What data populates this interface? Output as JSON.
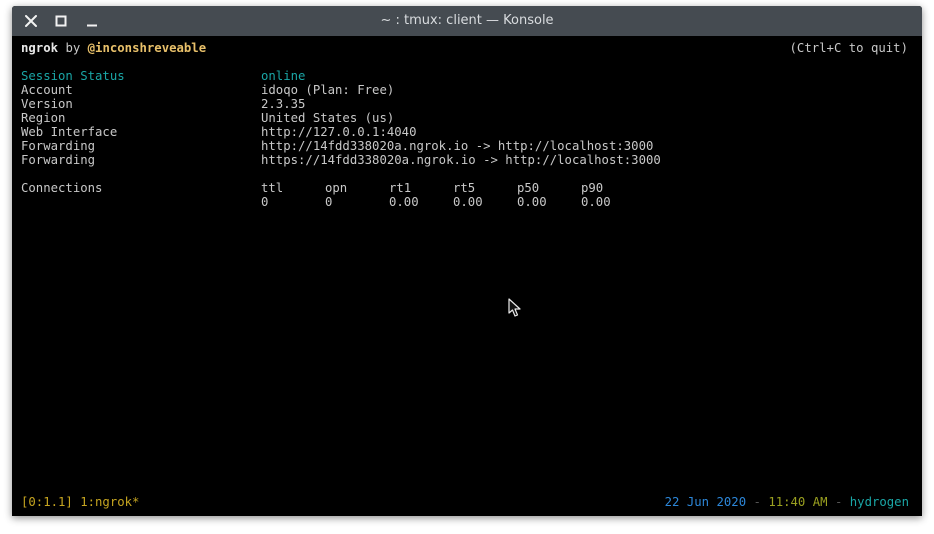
{
  "window": {
    "title": "~ : tmux: client — Konsole",
    "buttons": {
      "close_icon": "close-icon",
      "maximize_icon": "maximize-icon",
      "minimize_icon": "minimize-icon"
    }
  },
  "ngrok": {
    "brand": "ngrok",
    "by": "by",
    "author": "@inconshreveable",
    "quit_hint": "(Ctrl+C to quit)",
    "fields": [
      {
        "label": "Session Status",
        "value": "online"
      },
      {
        "label": "Account",
        "value": "idoqo (Plan: Free)"
      },
      {
        "label": "Version",
        "value": "2.3.35"
      },
      {
        "label": "Region",
        "value": "United States (us)"
      },
      {
        "label": "Web Interface",
        "value": "http://127.0.0.1:4040"
      },
      {
        "label": "Forwarding",
        "value": "http://14fdd338020a.ngrok.io -> http://localhost:3000"
      },
      {
        "label": "Forwarding",
        "value": "https://14fdd338020a.ngrok.io -> http://localhost:3000"
      }
    ],
    "connections": {
      "label": "Connections",
      "headers": [
        "ttl",
        "opn",
        "rt1",
        "rt5",
        "p50",
        "p90"
      ],
      "values": [
        "0",
        "0",
        "0.00",
        "0.00",
        "0.00",
        "0.00"
      ]
    }
  },
  "tmux": {
    "left": "[0:1.1] 1:ngrok*",
    "date": "22 Jun 2020",
    "sep1": " - ",
    "time": "11:40 AM",
    "sep2": " - ",
    "host": "hydrogen"
  },
  "colors": {
    "titlebar": "#454b51",
    "terminal_bg": "#000000",
    "teal": "#1aa6a6",
    "author_yellow": "#e8c06a",
    "tmux_yellow": "#c6a520",
    "date_blue": "#2c86d8",
    "time_olive": "#9aa020"
  }
}
